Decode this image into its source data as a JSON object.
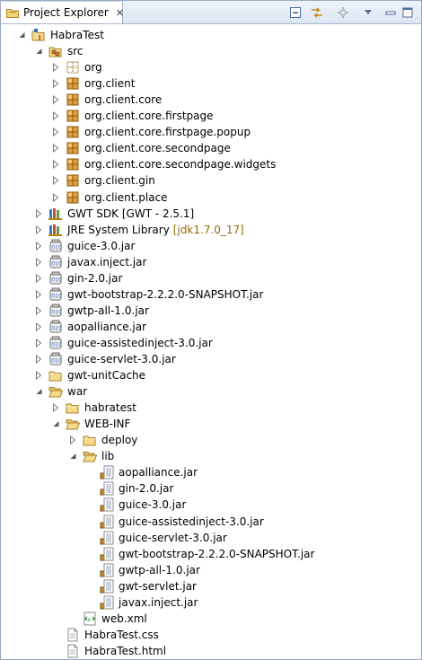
{
  "view": {
    "tab_title": "Project Explorer",
    "close_glyph": "✕"
  },
  "toolbar": {
    "icons": [
      "collapse-all-icon",
      "link-with-editor-icon",
      "filters-icon",
      "view-menu-icon",
      "minimize-icon",
      "maximize-icon"
    ]
  },
  "tree": [
    {
      "label": "HabraTest",
      "icon": "project",
      "expanded": true,
      "depth": 0
    },
    {
      "label": "src",
      "icon": "srcfolder",
      "expanded": true,
      "depth": 1
    },
    {
      "label": "org",
      "icon": "package-empty",
      "expanded": false,
      "depth": 2
    },
    {
      "label": "org.client",
      "icon": "package",
      "expanded": false,
      "depth": 2
    },
    {
      "label": "org.client.core",
      "icon": "package",
      "expanded": false,
      "depth": 2
    },
    {
      "label": "org.client.core.firstpage",
      "icon": "package",
      "expanded": false,
      "depth": 2
    },
    {
      "label": "org.client.core.firstpage.popup",
      "icon": "package",
      "expanded": false,
      "depth": 2
    },
    {
      "label": "org.client.core.secondpage",
      "icon": "package",
      "expanded": false,
      "depth": 2
    },
    {
      "label": "org.client.core.secondpage.widgets",
      "icon": "package",
      "expanded": false,
      "depth": 2
    },
    {
      "label": "org.client.gin",
      "icon": "package",
      "expanded": false,
      "depth": 2
    },
    {
      "label": "org.client.place",
      "icon": "package",
      "expanded": false,
      "depth": 2
    },
    {
      "label": "GWT SDK [GWT - 2.5.1]",
      "icon": "library",
      "expanded": false,
      "depth": 1
    },
    {
      "label": "JRE System Library",
      "icon": "library",
      "expanded": false,
      "depth": 1,
      "decoration": "[jdk1.7.0_17]"
    },
    {
      "label": "guice-3.0.jar",
      "icon": "jar",
      "expanded": false,
      "depth": 1
    },
    {
      "label": "javax.inject.jar",
      "icon": "jar",
      "expanded": false,
      "depth": 1
    },
    {
      "label": "gin-2.0.jar",
      "icon": "jar",
      "expanded": false,
      "depth": 1
    },
    {
      "label": "gwt-bootstrap-2.2.2.0-SNAPSHOT.jar",
      "icon": "jar",
      "expanded": false,
      "depth": 1
    },
    {
      "label": "gwtp-all-1.0.jar",
      "icon": "jar",
      "expanded": false,
      "depth": 1
    },
    {
      "label": "aopalliance.jar",
      "icon": "jar",
      "expanded": false,
      "depth": 1
    },
    {
      "label": "guice-assistedinject-3.0.jar",
      "icon": "jar",
      "expanded": false,
      "depth": 1
    },
    {
      "label": "guice-servlet-3.0.jar",
      "icon": "jar",
      "expanded": false,
      "depth": 1
    },
    {
      "label": "gwt-unitCache",
      "icon": "folder",
      "expanded": false,
      "depth": 1
    },
    {
      "label": "war",
      "icon": "folder-open",
      "expanded": true,
      "depth": 1
    },
    {
      "label": "habratest",
      "icon": "folder",
      "expanded": false,
      "depth": 2
    },
    {
      "label": "WEB-INF",
      "icon": "folder-open",
      "expanded": true,
      "depth": 2
    },
    {
      "label": "deploy",
      "icon": "folder",
      "expanded": false,
      "depth": 3
    },
    {
      "label": "lib",
      "icon": "folder-open",
      "expanded": true,
      "depth": 3
    },
    {
      "label": "aopalliance.jar",
      "icon": "jarfile",
      "depth": 4
    },
    {
      "label": "gin-2.0.jar",
      "icon": "jarfile",
      "depth": 4
    },
    {
      "label": "guice-3.0.jar",
      "icon": "jarfile",
      "depth": 4
    },
    {
      "label": "guice-assistedinject-3.0.jar",
      "icon": "jarfile",
      "depth": 4
    },
    {
      "label": "guice-servlet-3.0.jar",
      "icon": "jarfile",
      "depth": 4
    },
    {
      "label": "gwt-bootstrap-2.2.2.0-SNAPSHOT.jar",
      "icon": "jarfile",
      "depth": 4
    },
    {
      "label": "gwtp-all-1.0.jar",
      "icon": "jarfile",
      "depth": 4
    },
    {
      "label": "gwt-servlet.jar",
      "icon": "jarfile",
      "depth": 4
    },
    {
      "label": "javax.inject.jar",
      "icon": "jarfile",
      "depth": 4
    },
    {
      "label": "web.xml",
      "icon": "xml",
      "depth": 3
    },
    {
      "label": "HabraTest.css",
      "icon": "file",
      "depth": 2
    },
    {
      "label": "HabraTest.html",
      "icon": "file",
      "depth": 2
    }
  ]
}
